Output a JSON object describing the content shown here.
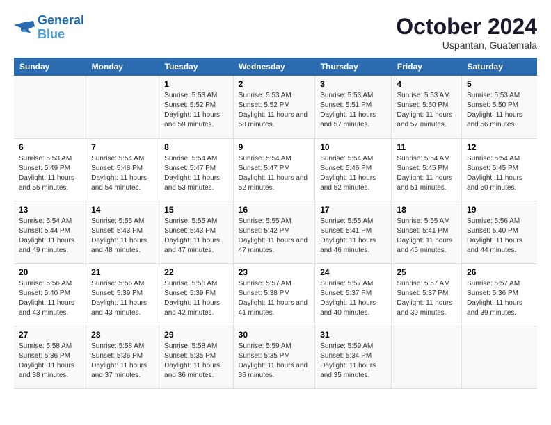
{
  "header": {
    "logo_line1": "General",
    "logo_line2": "Blue",
    "month": "October 2024",
    "location": "Uspantan, Guatemala"
  },
  "days_of_week": [
    "Sunday",
    "Monday",
    "Tuesday",
    "Wednesday",
    "Thursday",
    "Friday",
    "Saturday"
  ],
  "weeks": [
    [
      {
        "day": "",
        "info": ""
      },
      {
        "day": "",
        "info": ""
      },
      {
        "day": "1",
        "info": "Sunrise: 5:53 AM\nSunset: 5:52 PM\nDaylight: 11 hours and 59 minutes."
      },
      {
        "day": "2",
        "info": "Sunrise: 5:53 AM\nSunset: 5:52 PM\nDaylight: 11 hours and 58 minutes."
      },
      {
        "day": "3",
        "info": "Sunrise: 5:53 AM\nSunset: 5:51 PM\nDaylight: 11 hours and 57 minutes."
      },
      {
        "day": "4",
        "info": "Sunrise: 5:53 AM\nSunset: 5:50 PM\nDaylight: 11 hours and 57 minutes."
      },
      {
        "day": "5",
        "info": "Sunrise: 5:53 AM\nSunset: 5:50 PM\nDaylight: 11 hours and 56 minutes."
      }
    ],
    [
      {
        "day": "6",
        "info": "Sunrise: 5:53 AM\nSunset: 5:49 PM\nDaylight: 11 hours and 55 minutes."
      },
      {
        "day": "7",
        "info": "Sunrise: 5:54 AM\nSunset: 5:48 PM\nDaylight: 11 hours and 54 minutes."
      },
      {
        "day": "8",
        "info": "Sunrise: 5:54 AM\nSunset: 5:47 PM\nDaylight: 11 hours and 53 minutes."
      },
      {
        "day": "9",
        "info": "Sunrise: 5:54 AM\nSunset: 5:47 PM\nDaylight: 11 hours and 52 minutes."
      },
      {
        "day": "10",
        "info": "Sunrise: 5:54 AM\nSunset: 5:46 PM\nDaylight: 11 hours and 52 minutes."
      },
      {
        "day": "11",
        "info": "Sunrise: 5:54 AM\nSunset: 5:45 PM\nDaylight: 11 hours and 51 minutes."
      },
      {
        "day": "12",
        "info": "Sunrise: 5:54 AM\nSunset: 5:45 PM\nDaylight: 11 hours and 50 minutes."
      }
    ],
    [
      {
        "day": "13",
        "info": "Sunrise: 5:54 AM\nSunset: 5:44 PM\nDaylight: 11 hours and 49 minutes."
      },
      {
        "day": "14",
        "info": "Sunrise: 5:55 AM\nSunset: 5:43 PM\nDaylight: 11 hours and 48 minutes."
      },
      {
        "day": "15",
        "info": "Sunrise: 5:55 AM\nSunset: 5:43 PM\nDaylight: 11 hours and 47 minutes."
      },
      {
        "day": "16",
        "info": "Sunrise: 5:55 AM\nSunset: 5:42 PM\nDaylight: 11 hours and 47 minutes."
      },
      {
        "day": "17",
        "info": "Sunrise: 5:55 AM\nSunset: 5:41 PM\nDaylight: 11 hours and 46 minutes."
      },
      {
        "day": "18",
        "info": "Sunrise: 5:55 AM\nSunset: 5:41 PM\nDaylight: 11 hours and 45 minutes."
      },
      {
        "day": "19",
        "info": "Sunrise: 5:56 AM\nSunset: 5:40 PM\nDaylight: 11 hours and 44 minutes."
      }
    ],
    [
      {
        "day": "20",
        "info": "Sunrise: 5:56 AM\nSunset: 5:40 PM\nDaylight: 11 hours and 43 minutes."
      },
      {
        "day": "21",
        "info": "Sunrise: 5:56 AM\nSunset: 5:39 PM\nDaylight: 11 hours and 43 minutes."
      },
      {
        "day": "22",
        "info": "Sunrise: 5:56 AM\nSunset: 5:39 PM\nDaylight: 11 hours and 42 minutes."
      },
      {
        "day": "23",
        "info": "Sunrise: 5:57 AM\nSunset: 5:38 PM\nDaylight: 11 hours and 41 minutes."
      },
      {
        "day": "24",
        "info": "Sunrise: 5:57 AM\nSunset: 5:37 PM\nDaylight: 11 hours and 40 minutes."
      },
      {
        "day": "25",
        "info": "Sunrise: 5:57 AM\nSunset: 5:37 PM\nDaylight: 11 hours and 39 minutes."
      },
      {
        "day": "26",
        "info": "Sunrise: 5:57 AM\nSunset: 5:36 PM\nDaylight: 11 hours and 39 minutes."
      }
    ],
    [
      {
        "day": "27",
        "info": "Sunrise: 5:58 AM\nSunset: 5:36 PM\nDaylight: 11 hours and 38 minutes."
      },
      {
        "day": "28",
        "info": "Sunrise: 5:58 AM\nSunset: 5:36 PM\nDaylight: 11 hours and 37 minutes."
      },
      {
        "day": "29",
        "info": "Sunrise: 5:58 AM\nSunset: 5:35 PM\nDaylight: 11 hours and 36 minutes."
      },
      {
        "day": "30",
        "info": "Sunrise: 5:59 AM\nSunset: 5:35 PM\nDaylight: 11 hours and 36 minutes."
      },
      {
        "day": "31",
        "info": "Sunrise: 5:59 AM\nSunset: 5:34 PM\nDaylight: 11 hours and 35 minutes."
      },
      {
        "day": "",
        "info": ""
      },
      {
        "day": "",
        "info": ""
      }
    ]
  ]
}
